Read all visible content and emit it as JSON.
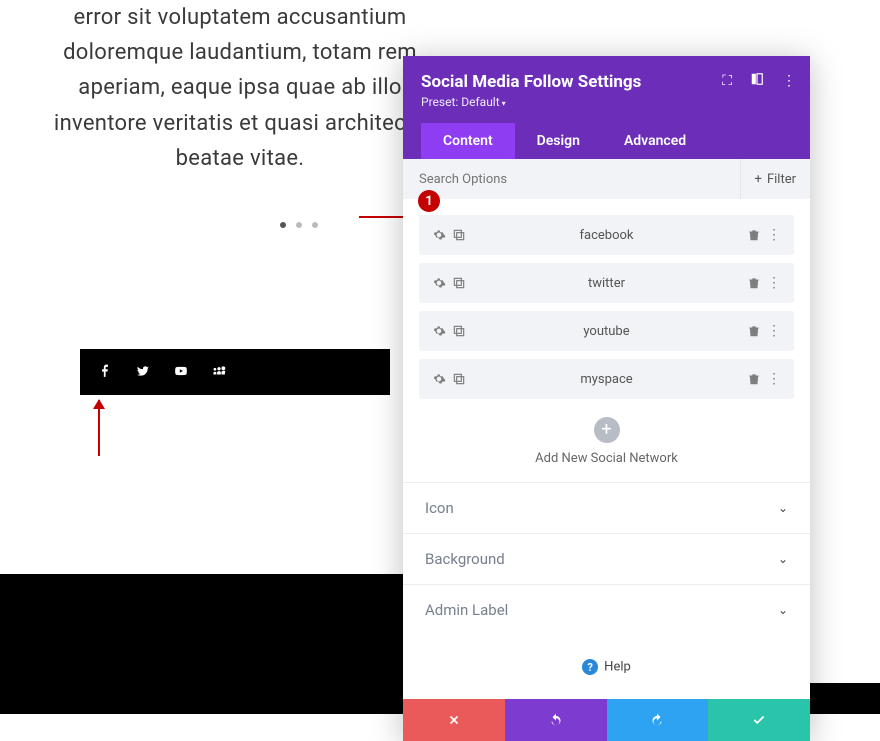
{
  "page": {
    "text": "error sit voluptatem accusantium doloremque laudantium, totam rem aperiam, eaque ipsa quae ab illo inventore veritatis et quasi architecto beatae vitae."
  },
  "callout": "1",
  "panel": {
    "title": "Social Media Follow Settings",
    "preset": "Preset: Default",
    "tabs": {
      "content": "Content",
      "design": "Design",
      "advanced": "Advanced"
    },
    "search_placeholder": "Search Options",
    "filter_label": "Filter",
    "items": [
      {
        "label": "facebook"
      },
      {
        "label": "twitter"
      },
      {
        "label": "youtube"
      },
      {
        "label": "myspace"
      }
    ],
    "add_label": "Add New Social Network",
    "accordions": {
      "icon": "Icon",
      "background": "Background",
      "admin_label": "Admin Label"
    },
    "help": "Help"
  }
}
